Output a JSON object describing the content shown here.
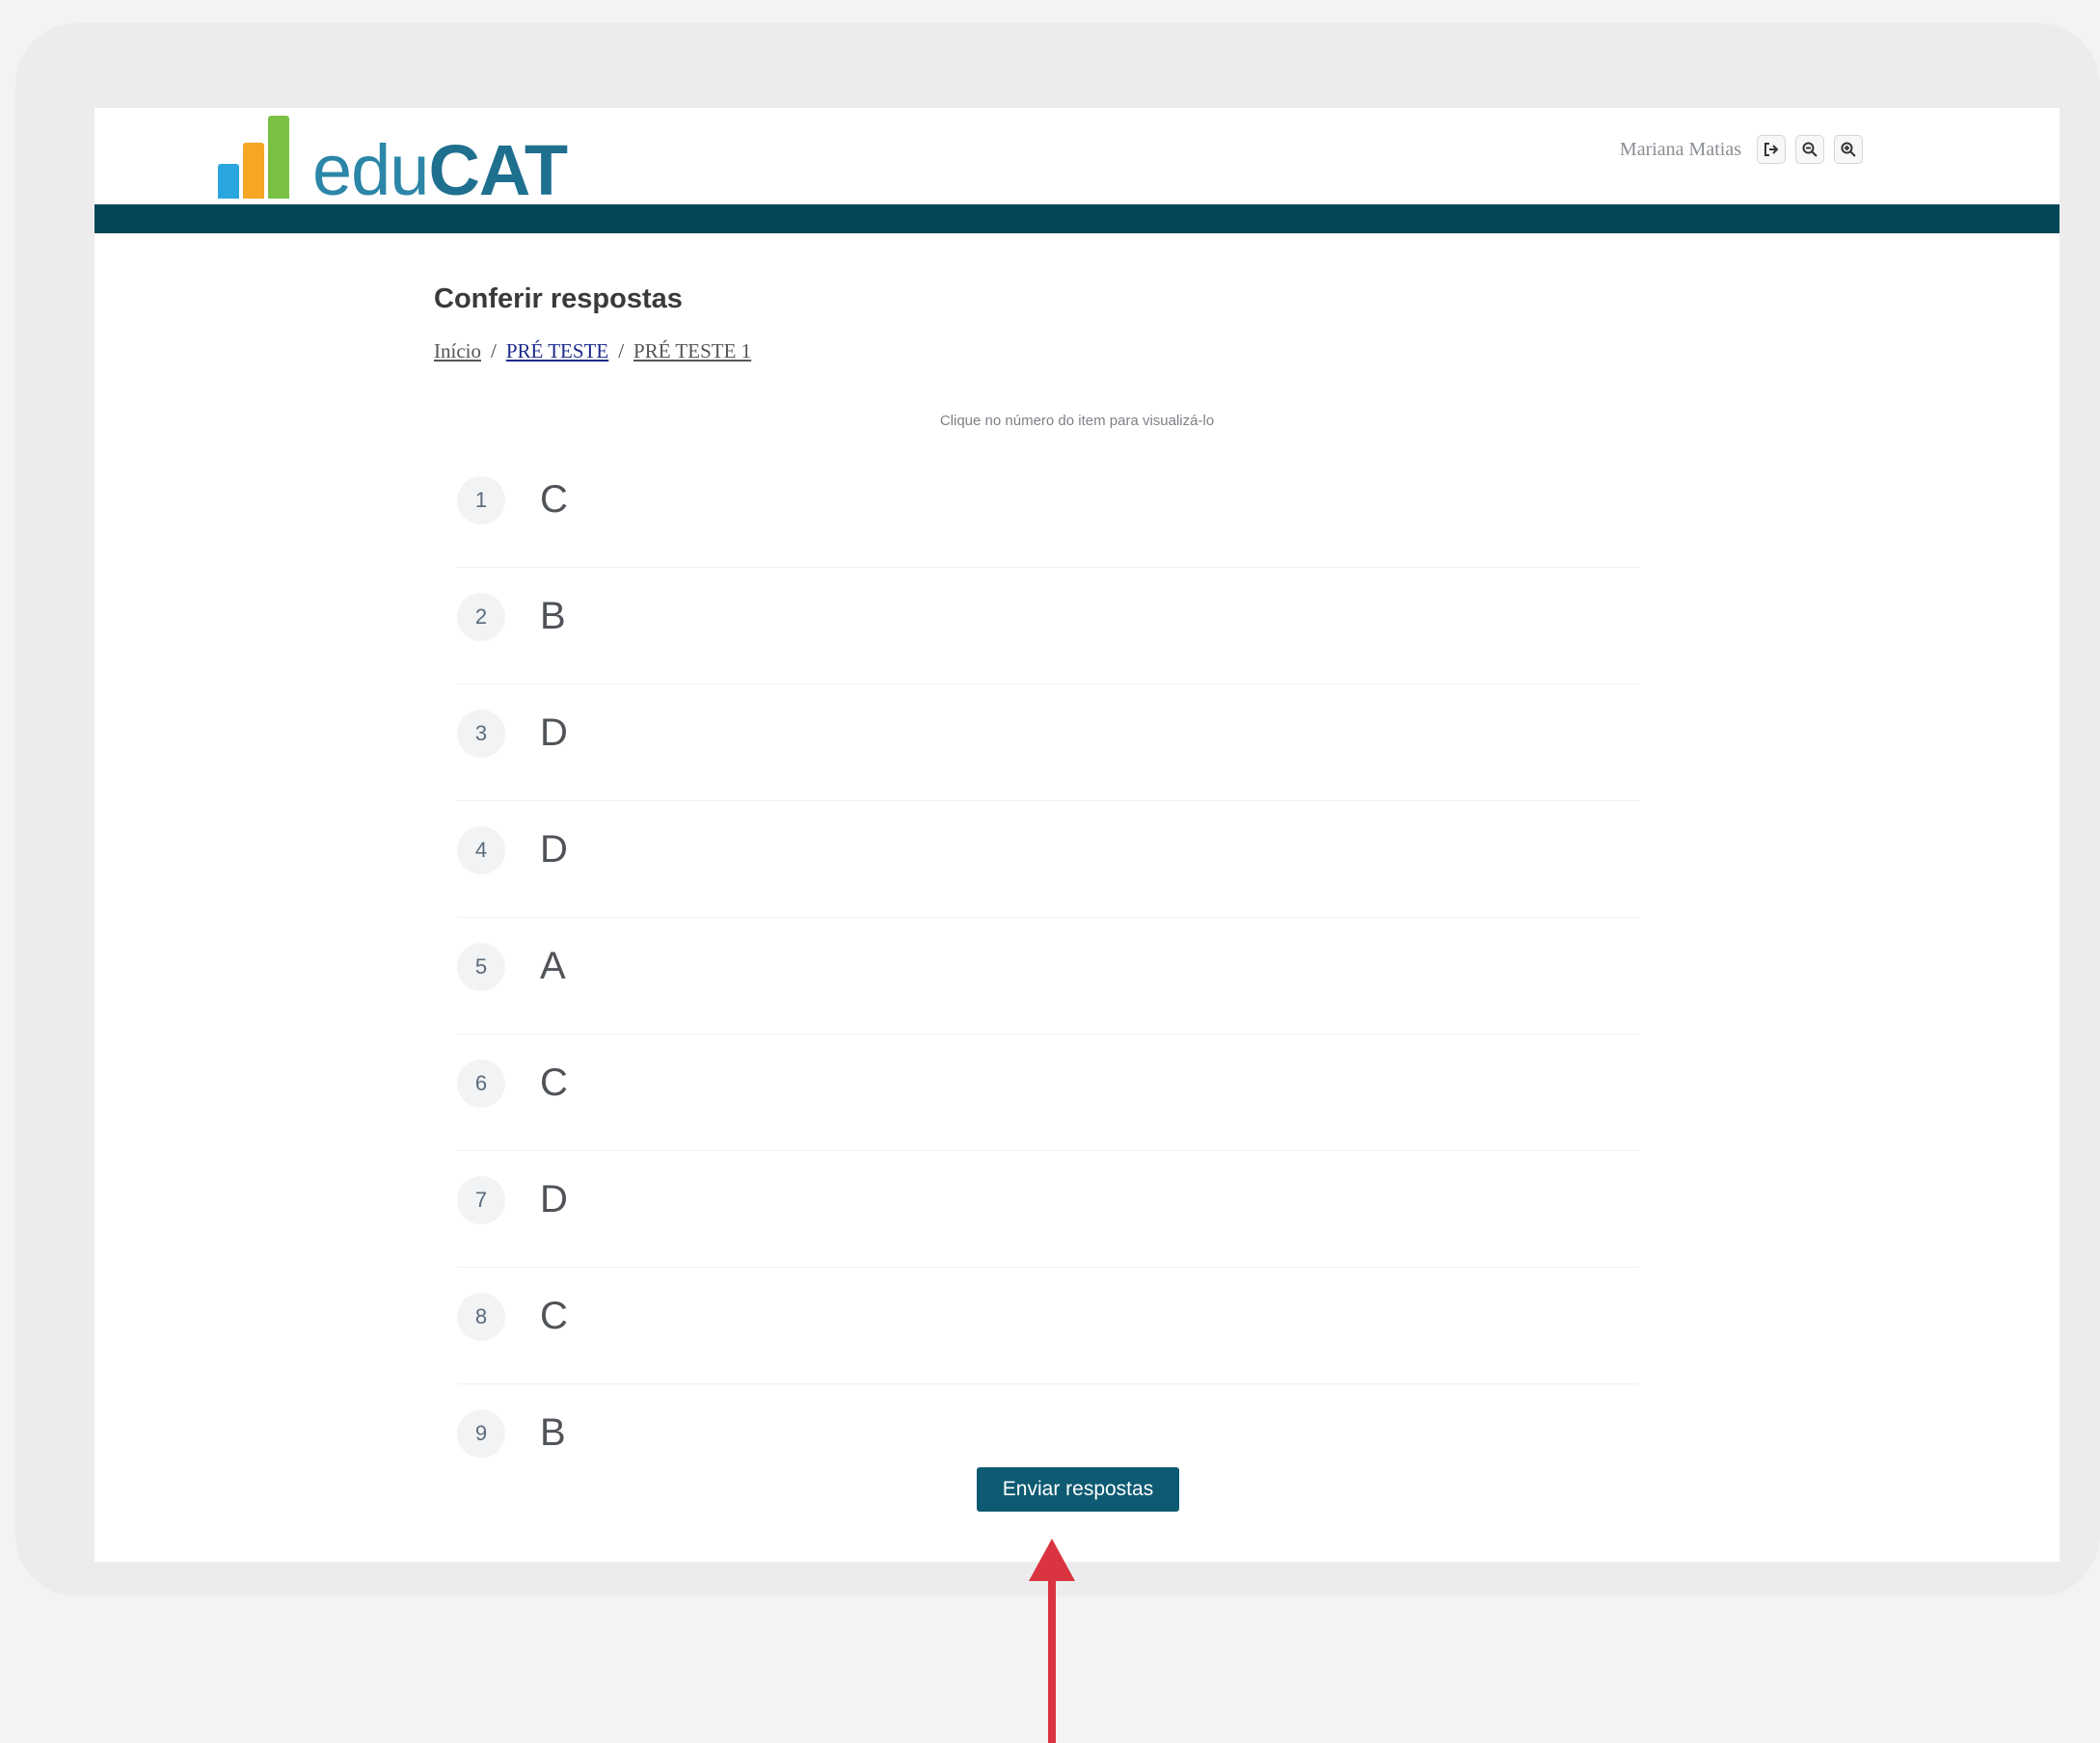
{
  "header": {
    "brand_prefix": "edu",
    "brand_suffix": "CAT",
    "user_name": "Mariana Matias",
    "icons": [
      "logout-icon",
      "zoom-out-icon",
      "zoom-in-icon"
    ]
  },
  "page": {
    "title": "Conferir respostas",
    "breadcrumb": [
      "Início",
      "PRÉ TESTE",
      "PRÉ TESTE 1"
    ],
    "hint": "Clique no número do item para visualizá-lo"
  },
  "answers": [
    {
      "num": "1",
      "letter": "C"
    },
    {
      "num": "2",
      "letter": "B"
    },
    {
      "num": "3",
      "letter": "D"
    },
    {
      "num": "4",
      "letter": "D"
    },
    {
      "num": "5",
      "letter": "A"
    },
    {
      "num": "6",
      "letter": "C"
    },
    {
      "num": "7",
      "letter": "D"
    },
    {
      "num": "8",
      "letter": "C"
    },
    {
      "num": "9",
      "letter": "B"
    }
  ],
  "actions": {
    "submit_label": "Enviar respostas"
  },
  "colors": {
    "navbar": "#044658",
    "button": "#0e5a72",
    "arrow": "#d9343f"
  }
}
